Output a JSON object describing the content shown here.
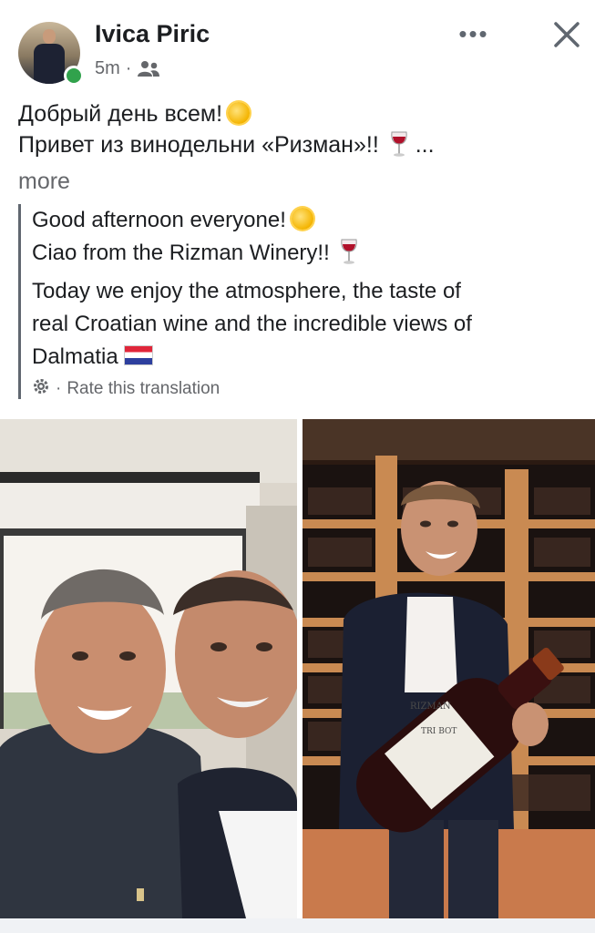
{
  "post": {
    "author": "Ivica Piric",
    "time": "5m",
    "separator": "·",
    "audience_icon": "friends-icon",
    "more_icon": "•••"
  },
  "caption": {
    "line1": "Добрый день всем!",
    "line2": "Привет из винодельни «Ризман»!!",
    "ellipsis": "...",
    "more": "more"
  },
  "translation": {
    "line1": "Good afternoon everyone!",
    "line2": "Ciao from the Rizman Winery!!",
    "line3": "Today we enjoy the atmosphere, the taste of",
    "line4": "real Croatian wine and the incredible views of",
    "line5": "Dalmatia",
    "rate": "Rate this translation",
    "rate_separator": "·"
  },
  "photos": [
    {
      "name": "selfie-photo",
      "description_icon": "photo"
    },
    {
      "name": "wine-cellar-photo",
      "description_icon": "photo"
    }
  ],
  "bottle_label": {
    "brand": "RIZMAN",
    "wine": "TRI BOT"
  },
  "colors": {
    "text": "#1c1e21",
    "secondary": "#65676b",
    "online": "#31a24c"
  }
}
